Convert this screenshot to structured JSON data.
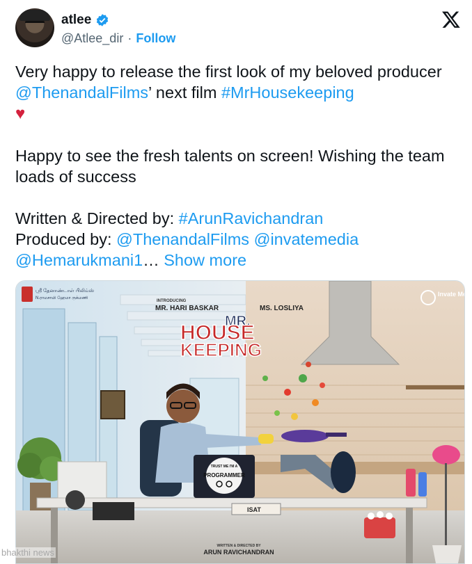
{
  "author": {
    "display_name": "atlee",
    "handle": "@Atlee_dir",
    "separator": "·",
    "follow_label": "Follow"
  },
  "tweet": {
    "p1_text_a": "Very happy to release the first look of my beloved producer ",
    "p1_mention": "@ThenandalFilms",
    "p1_text_b": "’ next film ",
    "p1_hashtag": "#MrHousekeeping",
    "p1_heart": "♥",
    "p2_text": "Happy to see the fresh talents on screen! Wishing the team loads of success",
    "p3_line1_text": "Written & Directed by: ",
    "p3_line1_hashtag": "#ArunRavichandran",
    "p3_line2_text": "Produced by: ",
    "p3_line2_mention1": "@ThenandalFilms",
    "p3_line2_mention2": "@invatemedia",
    "p3_line3_mention": "@Hemarukmani1",
    "p3_line3_ellipsis": "…",
    "show_more": "Show more"
  },
  "poster": {
    "introducing": "INTRODUCING",
    "actor1": "MR. HARI BASKAR",
    "actor2": "MS. LOSLIYA",
    "title_mr": "MR.",
    "title_house": "HOUSE",
    "title_keeping": "KEEPING",
    "logo_right": "Invate Media",
    "laptop_sticker_top": "TRUST ME I'M A",
    "laptop_sticker_main": "PROGRAMMER",
    "credit_top": "WRITTEN & DIRECTED BY",
    "credit_name": "ARUN RAVICHANDRAN",
    "left_logo_line1": "ஸ்ரீ தேனாண்டாள் பிலிம்ஸ்",
    "left_logo_line2": "N.ராமசாமி ஹேமா ருக்மணி",
    "desk_sign": "ISAT"
  },
  "watermark": "bhakthi news",
  "colors": {
    "link": "#1d9bf0",
    "text": "#0f1419",
    "muted": "#536471",
    "heart": "#d4213d",
    "title_red": "#c62828"
  }
}
